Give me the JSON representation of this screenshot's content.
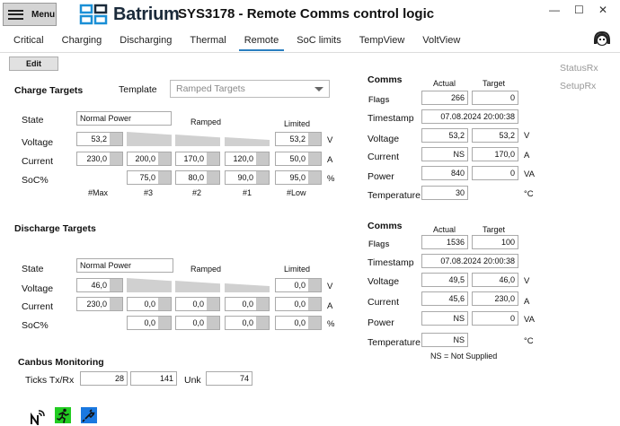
{
  "header": {
    "menu_label": "Menu",
    "logo_text": "Batrium",
    "title": "SYS3178 - Remote Comms control logic",
    "minimize": "—",
    "maximize": "☐",
    "close": "✕"
  },
  "tabs": [
    "Critical",
    "Charging",
    "Discharging",
    "Thermal",
    "Remote",
    "SoC limits",
    "TempView",
    "VoltView"
  ],
  "active_tab": "Remote",
  "toolbar": {
    "edit_label": "Edit"
  },
  "side_links": {
    "status_rx": "StatusRx",
    "setup_rx": "SetupRx"
  },
  "charge": {
    "heading": "Charge Targets",
    "template_label": "Template",
    "template_value": "Ramped Targets",
    "state_label": "State",
    "state_value": "Normal Power",
    "ramped_label": "Ramped",
    "limited_label": "Limited",
    "voltage_label": "Voltage",
    "current_label": "Current",
    "soc_label": "SoC%",
    "voltage_max": "53,2",
    "voltage_limited": "53,2",
    "voltage_unit": "V",
    "current_values": [
      "230,0",
      "200,0",
      "170,0",
      "120,0"
    ],
    "current_limited": "50,0",
    "current_unit": "A",
    "soc_values": [
      "75,0",
      "80,0",
      "90,0"
    ],
    "soc_limited": "95,0",
    "soc_unit": "%",
    "col_labels": [
      "#Max",
      "#3",
      "#2",
      "#1",
      "#Low"
    ]
  },
  "discharge": {
    "heading": "Discharge Targets",
    "state_label": "State",
    "state_value": "Normal Power",
    "ramped_label": "Ramped",
    "limited_label": "Limited",
    "voltage_label": "Voltage",
    "current_label": "Current",
    "soc_label": "SoC%",
    "voltage_max": "46,0",
    "voltage_limited": "0,0",
    "voltage_unit": "V",
    "current_values": [
      "230,0",
      "0,0",
      "0,0",
      "0,0"
    ],
    "current_limited": "0,0",
    "current_unit": "A",
    "soc_values": [
      "0,0",
      "0,0",
      "0,0"
    ],
    "soc_limited": "0,0",
    "soc_unit": "%"
  },
  "comms_charge": {
    "heading": "Comms",
    "actual_label": "Actual",
    "target_label": "Target",
    "flags_label": "Flags",
    "flags_actual": "266",
    "flags_target": "0",
    "timestamp_label": "Timestamp",
    "timestamp_value": "07.08.2024 20:00:38",
    "voltage_label": "Voltage",
    "voltage_actual": "53,2",
    "voltage_target": "53,2",
    "voltage_unit": "V",
    "current_label": "Current",
    "current_actual": "NS",
    "current_target": "170,0",
    "current_unit": "A",
    "power_label": "Power",
    "power_actual": "840",
    "power_target": "0",
    "power_unit": "VA",
    "temp_label": "Temperature",
    "temp_actual": "30",
    "temp_unit": "°C"
  },
  "comms_discharge": {
    "heading": "Comms",
    "actual_label": "Actual",
    "target_label": "Target",
    "flags_label": "Flags",
    "flags_actual": "1536",
    "flags_target": "100",
    "timestamp_label": "Timestamp",
    "timestamp_value": "07.08.2024 20:00:38",
    "voltage_label": "Voltage",
    "voltage_actual": "49,5",
    "voltage_target": "46,0",
    "voltage_unit": "V",
    "current_label": "Current",
    "current_actual": "45,6",
    "current_target": "230,0",
    "current_unit": "A",
    "power_label": "Power",
    "power_actual": "NS",
    "power_target": "0",
    "power_unit": "VA",
    "temp_label": "Temperature",
    "temp_actual": "NS",
    "temp_unit": "°C",
    "note": "NS = Not Supplied"
  },
  "canbus": {
    "heading": "Canbus Monitoring",
    "ticks_label": "Ticks Tx/Rx",
    "tx": "28",
    "rx": "141",
    "unk_label": "Unk",
    "unk": "74"
  },
  "status_icons": [
    "network-icon",
    "running-man-icon",
    "plug-icon"
  ],
  "colors": {
    "accent": "#2a7fc0",
    "brand": "#1a8fd6",
    "green": "#22cc22",
    "blue": "#1a78e0"
  }
}
